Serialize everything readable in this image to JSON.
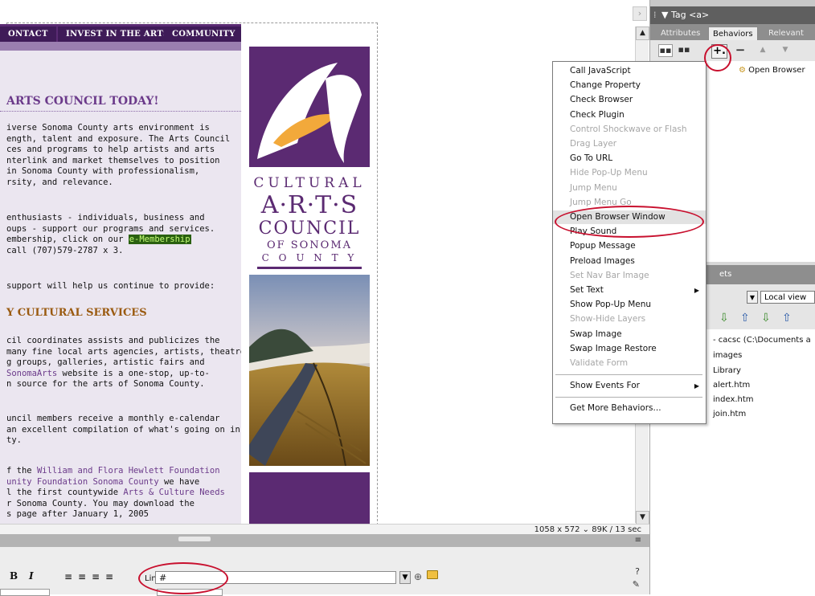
{
  "site": {
    "nav_tabs": [
      "ONTACT",
      "INVEST IN THE ARTS",
      "COMMUNITY"
    ],
    "heading": "ARTS COUNCIL TODAY!",
    "paragraphs": [
      [
        "iverse Sonoma County arts environment is",
        "ength, talent and exposure. The Arts Council",
        "ces and programs to help artists and arts",
        "nterlink and market themselves to position",
        "in Sonoma County with professionalism,",
        "rsity, and relevance."
      ],
      [
        "enthusiasts - individuals, business and",
        "oups - support our programs and services.",
        "embership, click on our ",
        "call (707)579-2787 x 3."
      ],
      [
        "support will help us continue to provide:"
      ]
    ],
    "membership_link": "e-Membership",
    "subheading": "Y CULTURAL SERVICES",
    "services_lines": [
      "cil coordinates assists and publicizes the",
      "many fine local arts agencies, artists, theatre",
      "g groups, galleries, artistic fairs and",
      " website is a one-stop, up-to-",
      "n source for the arts of Sonoma County."
    ],
    "sonomaarts_link": "SonomaArts",
    "calendar_lines": [
      "uncil members receive a monthly e-calendar",
      "an excellent compilation of what's going on in",
      "ty."
    ],
    "hewlett_lines": [
      "f the ",
      "unity Foundation Sonoma County",
      " we have",
      "l the first countywide ",
      "r Sonoma County. You may download the",
      "s page after January 1, 2005"
    ],
    "hewlett_link": "William and Flora Hewlett Foundation",
    "needs_link": "Arts & Culture Needs",
    "logo": {
      "line1": "CULTURAL",
      "line2": "A·R·T·S",
      "line3": "COUNCIL",
      "line4": "OF SONOMA",
      "line5": "C O U N T Y"
    }
  },
  "status_bar": {
    "text": "1058 x 572 ⌄ 89K / 13 sec"
  },
  "property_inspector": {
    "bold": "B",
    "italic": "I",
    "link_label": "Link",
    "link_value": "#"
  },
  "tag_panel": {
    "title": "▼ Tag <a>",
    "tabs": [
      "Attributes",
      "Behaviors",
      "Relevant"
    ],
    "add_label": "+.",
    "remove_label": "−",
    "up_label": "▲",
    "down_label": "▼",
    "behavior_row": "Open Browser"
  },
  "behaviors_menu": {
    "items": [
      {
        "label": "Call JavaScript",
        "enabled": true
      },
      {
        "label": "Change Property",
        "enabled": true
      },
      {
        "label": "Check Browser",
        "enabled": true
      },
      {
        "label": "Check Plugin",
        "enabled": true
      },
      {
        "label": "Control Shockwave or Flash",
        "enabled": false
      },
      {
        "label": "Drag Layer",
        "enabled": false
      },
      {
        "label": "Go To URL",
        "enabled": true
      },
      {
        "label": "Hide Pop-Up Menu",
        "enabled": false
      },
      {
        "label": "Jump Menu",
        "enabled": false
      },
      {
        "label": "Jump Menu Go",
        "enabled": false
      },
      {
        "label": "Open Browser Window",
        "enabled": true,
        "selected": true
      },
      {
        "label": "Play Sound",
        "enabled": true
      },
      {
        "label": "Popup Message",
        "enabled": true
      },
      {
        "label": "Preload Images",
        "enabled": true
      },
      {
        "label": "Set Nav Bar Image",
        "enabled": false
      },
      {
        "label": "Set Text",
        "enabled": true,
        "submenu": true
      },
      {
        "label": "Show Pop-Up Menu",
        "enabled": true
      },
      {
        "label": "Show-Hide Layers",
        "enabled": false
      },
      {
        "label": "Swap Image",
        "enabled": true
      },
      {
        "label": "Swap Image Restore",
        "enabled": true
      },
      {
        "label": "Validate Form",
        "enabled": false
      }
    ],
    "show_events": "Show Events For",
    "get_more": "Get More Behaviors..."
  },
  "files_panel": {
    "title": "ets",
    "view": "Local view",
    "items": [
      "- cacsc (C:\\Documents a",
      "images",
      "Library",
      "alert.htm",
      "index.htm",
      "join.htm"
    ]
  },
  "colors": {
    "brand_purple": "#5b2a72",
    "logo_gold": "#f2a93b",
    "annotation_red": "#c8102e"
  }
}
